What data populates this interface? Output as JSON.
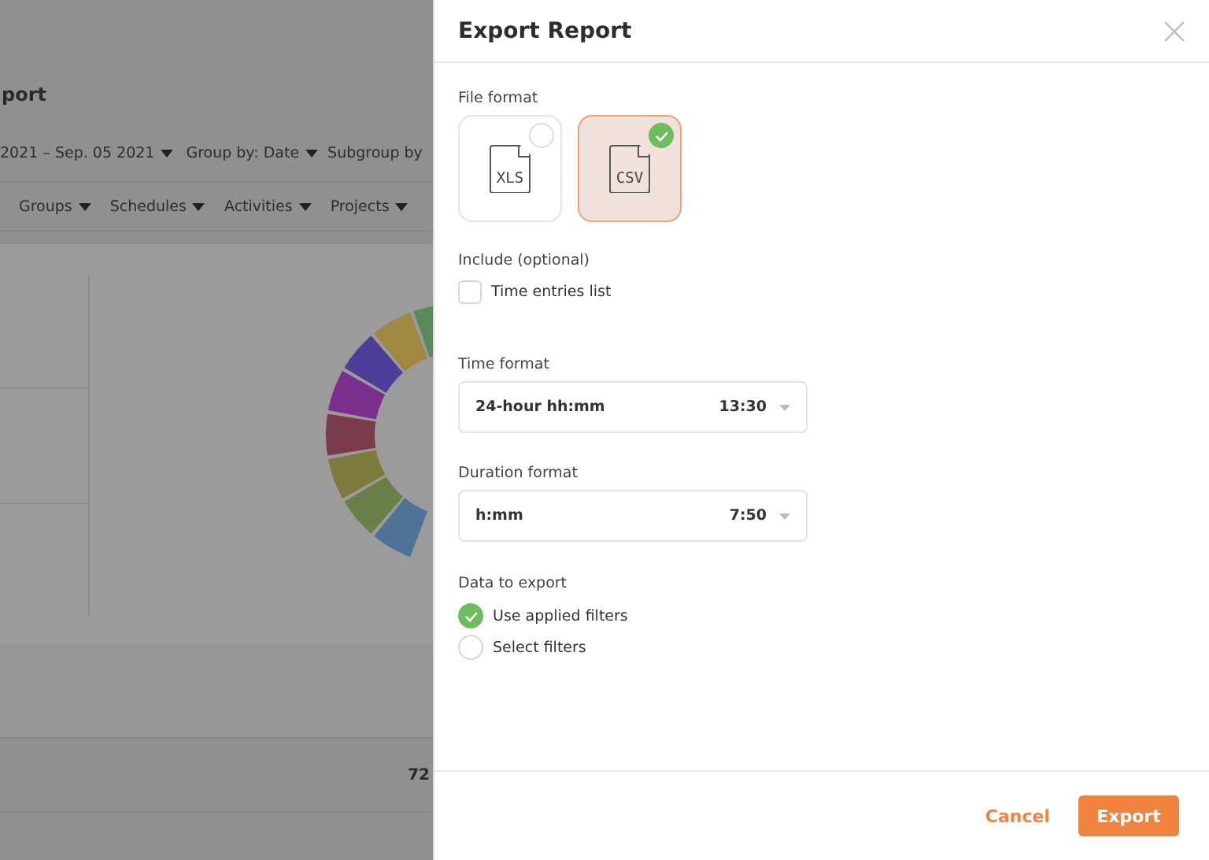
{
  "background": {
    "title": "port",
    "date_range": "2021 – Sep. 05 2021",
    "group_by": "Group by: Date",
    "subgroup_by": "Subgroup by",
    "filters": [
      "Groups",
      "Schedules",
      "Activities",
      "Projects"
    ],
    "total": "72"
  },
  "dialog": {
    "title": "Export Report",
    "file_format": {
      "label": "File format",
      "options": [
        {
          "label": "XLS",
          "selected": false
        },
        {
          "label": "CSV",
          "selected": true
        }
      ]
    },
    "include": {
      "label": "Include (optional)",
      "items": [
        {
          "label": "Time entries list",
          "checked": false
        }
      ]
    },
    "time_format": {
      "label": "Time format",
      "value": "24-hour hh:mm",
      "example": "13:30"
    },
    "duration_format": {
      "label": "Duration format",
      "value": "h:mm",
      "example": "7:50"
    },
    "data_to_export": {
      "label": "Data to export",
      "options": [
        {
          "label": "Use applied filters",
          "selected": true
        },
        {
          "label": "Select filters",
          "selected": false
        }
      ]
    },
    "buttons": [
      {
        "kind": "cancel",
        "label": "Cancel"
      },
      {
        "kind": "export",
        "label": "Export"
      }
    ]
  }
}
